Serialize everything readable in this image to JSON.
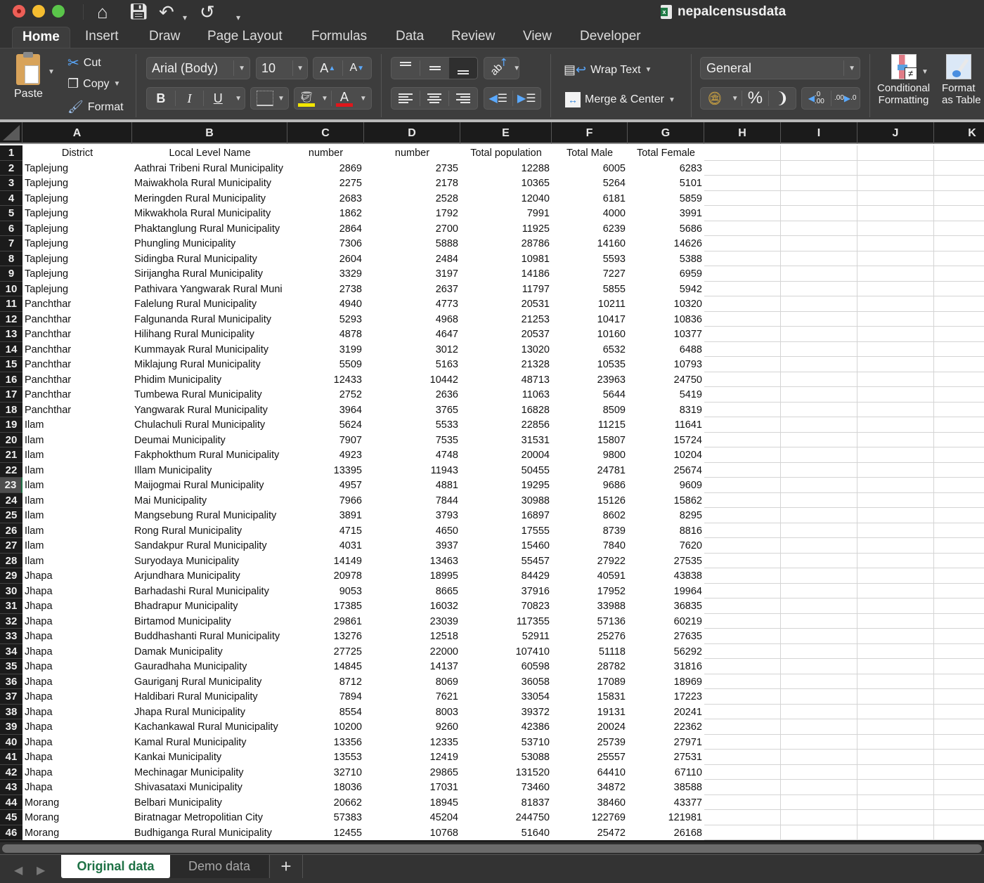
{
  "window": {
    "title": "nepalcensusdata",
    "quick_access": [
      "home-icon",
      "save-icon",
      "undo-icon",
      "redo-icon",
      "customize-icon"
    ]
  },
  "ribbon_tabs": [
    "Home",
    "Insert",
    "Draw",
    "Page Layout",
    "Formulas",
    "Data",
    "Review",
    "View",
    "Developer"
  ],
  "active_tab": "Home",
  "clipboard": {
    "paste": "Paste",
    "cut": "Cut",
    "copy": "Copy",
    "format": "Format"
  },
  "font": {
    "name": "Arial (Body)",
    "size": "10",
    "bold": "B",
    "italic": "I",
    "underline": "U",
    "highlight_color": "#f2e600",
    "font_color": "#e0161b"
  },
  "alignment": {
    "wrap_text": "Wrap Text",
    "merge_center": "Merge & Center"
  },
  "number": {
    "format": "General",
    "percent": "%",
    "comma": ",",
    "inc_decimal": ".0 .00",
    "dec_decimal": ".00 .0"
  },
  "styles": {
    "conditional_formatting_line1": "Conditional",
    "conditional_formatting_line2": "Formatting",
    "format_table_line1": "Format",
    "format_table_line2": "as Table"
  },
  "columns": [
    "A",
    "B",
    "C",
    "D",
    "E",
    "F",
    "G",
    "H",
    "I",
    "J",
    "K"
  ],
  "header_row": {
    "row": "1",
    "A": "District",
    "B": "Local Level Name",
    "C": "number",
    "D": "number",
    "E": "Total population",
    "F": "Total Male",
    "G": "Total Female"
  },
  "selected_row": "23",
  "rows": [
    [
      "2",
      "Taplejung",
      "Aathrai Tribeni Rural Municipality",
      "2869",
      "2735",
      "12288",
      "6005",
      "6283"
    ],
    [
      "3",
      "Taplejung",
      "Maiwakhola Rural Municipality",
      "2275",
      "2178",
      "10365",
      "5264",
      "5101"
    ],
    [
      "4",
      "Taplejung",
      "Meringden Rural Municipality",
      "2683",
      "2528",
      "12040",
      "6181",
      "5859"
    ],
    [
      "5",
      "Taplejung",
      "Mikwakhola Rural Municipality",
      "1862",
      "1792",
      "7991",
      "4000",
      "3991"
    ],
    [
      "6",
      "Taplejung",
      "Phaktanglung Rural Municipality",
      "2864",
      "2700",
      "11925",
      "6239",
      "5686"
    ],
    [
      "7",
      "Taplejung",
      "Phungling Municipality",
      "7306",
      "5888",
      "28786",
      "14160",
      "14626"
    ],
    [
      "8",
      "Taplejung",
      "Sidingba Rural Municipality",
      "2604",
      "2484",
      "10981",
      "5593",
      "5388"
    ],
    [
      "9",
      "Taplejung",
      "Sirijangha Rural Municipality",
      "3329",
      "3197",
      "14186",
      "7227",
      "6959"
    ],
    [
      "10",
      "Taplejung",
      "Pathivara Yangwarak Rural Muni",
      "2738",
      "2637",
      "11797",
      "5855",
      "5942"
    ],
    [
      "11",
      "Panchthar",
      "Falelung Rural Municipality",
      "4940",
      "4773",
      "20531",
      "10211",
      "10320"
    ],
    [
      "12",
      "Panchthar",
      "Falgunanda Rural Municipality",
      "5293",
      "4968",
      "21253",
      "10417",
      "10836"
    ],
    [
      "13",
      "Panchthar",
      "Hilihang Rural Municipality",
      "4878",
      "4647",
      "20537",
      "10160",
      "10377"
    ],
    [
      "14",
      "Panchthar",
      "Kummayak Rural Municipality",
      "3199",
      "3012",
      "13020",
      "6532",
      "6488"
    ],
    [
      "15",
      "Panchthar",
      "Miklajung Rural Municipality",
      "5509",
      "5163",
      "21328",
      "10535",
      "10793"
    ],
    [
      "16",
      "Panchthar",
      "Phidim Municipality",
      "12433",
      "10442",
      "48713",
      "23963",
      "24750"
    ],
    [
      "17",
      "Panchthar",
      "Tumbewa Rural Municipality",
      "2752",
      "2636",
      "11063",
      "5644",
      "5419"
    ],
    [
      "18",
      "Panchthar",
      "Yangwarak Rural Municipality",
      "3964",
      "3765",
      "16828",
      "8509",
      "8319"
    ],
    [
      "19",
      "Ilam",
      "Chulachuli Rural Municipality",
      "5624",
      "5533",
      "22856",
      "11215",
      "11641"
    ],
    [
      "20",
      "Ilam",
      "Deumai Municipality",
      "7907",
      "7535",
      "31531",
      "15807",
      "15724"
    ],
    [
      "21",
      "Ilam",
      "Fakphokthum Rural Municipality",
      "4923",
      "4748",
      "20004",
      "9800",
      "10204"
    ],
    [
      "22",
      "Ilam",
      "Illam Municipality",
      "13395",
      "11943",
      "50455",
      "24781",
      "25674"
    ],
    [
      "23",
      "Ilam",
      "Maijogmai Rural Municipality",
      "4957",
      "4881",
      "19295",
      "9686",
      "9609"
    ],
    [
      "24",
      "Ilam",
      "Mai Municipality",
      "7966",
      "7844",
      "30988",
      "15126",
      "15862"
    ],
    [
      "25",
      "Ilam",
      "Mangsebung Rural Municipality",
      "3891",
      "3793",
      "16897",
      "8602",
      "8295"
    ],
    [
      "26",
      "Ilam",
      "Rong Rural Municipality",
      "4715",
      "4650",
      "17555",
      "8739",
      "8816"
    ],
    [
      "27",
      "Ilam",
      "Sandakpur Rural Municipality",
      "4031",
      "3937",
      "15460",
      "7840",
      "7620"
    ],
    [
      "28",
      "Ilam",
      "Suryodaya Municipality",
      "14149",
      "13463",
      "55457",
      "27922",
      "27535"
    ],
    [
      "29",
      "Jhapa",
      "Arjundhara Municipality",
      "20978",
      "18995",
      "84429",
      "40591",
      "43838"
    ],
    [
      "30",
      "Jhapa",
      "Barhadashi Rural Municipality",
      "9053",
      "8665",
      "37916",
      "17952",
      "19964"
    ],
    [
      "31",
      "Jhapa",
      "Bhadrapur Municipality",
      "17385",
      "16032",
      "70823",
      "33988",
      "36835"
    ],
    [
      "32",
      "Jhapa",
      "Birtamod Municipality",
      "29861",
      "23039",
      "117355",
      "57136",
      "60219"
    ],
    [
      "33",
      "Jhapa",
      "Buddhashanti Rural Municipality",
      "13276",
      "12518",
      "52911",
      "25276",
      "27635"
    ],
    [
      "34",
      "Jhapa",
      "Damak Municipality",
      "27725",
      "22000",
      "107410",
      "51118",
      "56292"
    ],
    [
      "35",
      "Jhapa",
      "Gauradhaha Municipality",
      "14845",
      "14137",
      "60598",
      "28782",
      "31816"
    ],
    [
      "36",
      "Jhapa",
      "Gauriganj Rural Municipality",
      "8712",
      "8069",
      "36058",
      "17089",
      "18969"
    ],
    [
      "37",
      "Jhapa",
      "Haldibari Rural Municipality",
      "7894",
      "7621",
      "33054",
      "15831",
      "17223"
    ],
    [
      "38",
      "Jhapa",
      "Jhapa Rural Municipality",
      "8554",
      "8003",
      "39372",
      "19131",
      "20241"
    ],
    [
      "39",
      "Jhapa",
      "Kachankawal Rural Municipality",
      "10200",
      "9260",
      "42386",
      "20024",
      "22362"
    ],
    [
      "40",
      "Jhapa",
      "Kamal Rural Municipality",
      "13356",
      "12335",
      "53710",
      "25739",
      "27971"
    ],
    [
      "41",
      "Jhapa",
      "Kankai Municipality",
      "13553",
      "12419",
      "53088",
      "25557",
      "27531"
    ],
    [
      "42",
      "Jhapa",
      "Mechinagar Municipality",
      "32710",
      "29865",
      "131520",
      "64410",
      "67110"
    ],
    [
      "43",
      "Jhapa",
      "Shivasataxi Municipality",
      "18036",
      "17031",
      "73460",
      "34872",
      "38588"
    ],
    [
      "44",
      "Morang",
      "Belbari Municipality",
      "20662",
      "18945",
      "81837",
      "38460",
      "43377"
    ],
    [
      "45",
      "Morang",
      "Biratnagar Metropolitian City",
      "57383",
      "45204",
      "244750",
      "122769",
      "121981"
    ],
    [
      "46",
      "Morang",
      "Budhiganga Rural Municipality",
      "12455",
      "10768",
      "51640",
      "25472",
      "26168"
    ]
  ],
  "sheets": [
    {
      "name": "Original data",
      "active": true
    },
    {
      "name": "Demo data",
      "active": false
    }
  ],
  "add_sheet": "+"
}
